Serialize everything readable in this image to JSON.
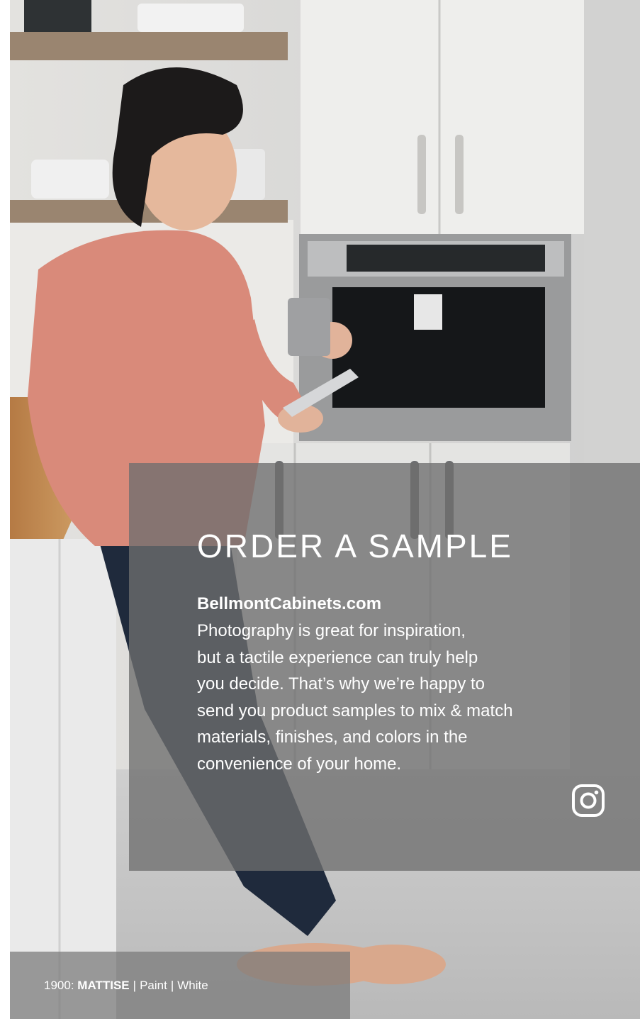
{
  "hero": {
    "image_description_icon": "kitchen-photo-woman-with-phone-icon"
  },
  "sample": {
    "heading": "ORDER A SAMPLE",
    "website": "BellmontCabinets.com",
    "body_lines": [
      "Photography is great for inspiration,",
      "but a tactile experience can truly help",
      "you decide. That’s why we’re happy to",
      "send you product samples to mix & match",
      "materials, finishes, and colors in the",
      "convenience of your home."
    ],
    "social_icon": "instagram-icon"
  },
  "caption": {
    "code": "1900:",
    "name": "MATTISE",
    "separator": "|",
    "material": "Paint",
    "color": "White"
  }
}
